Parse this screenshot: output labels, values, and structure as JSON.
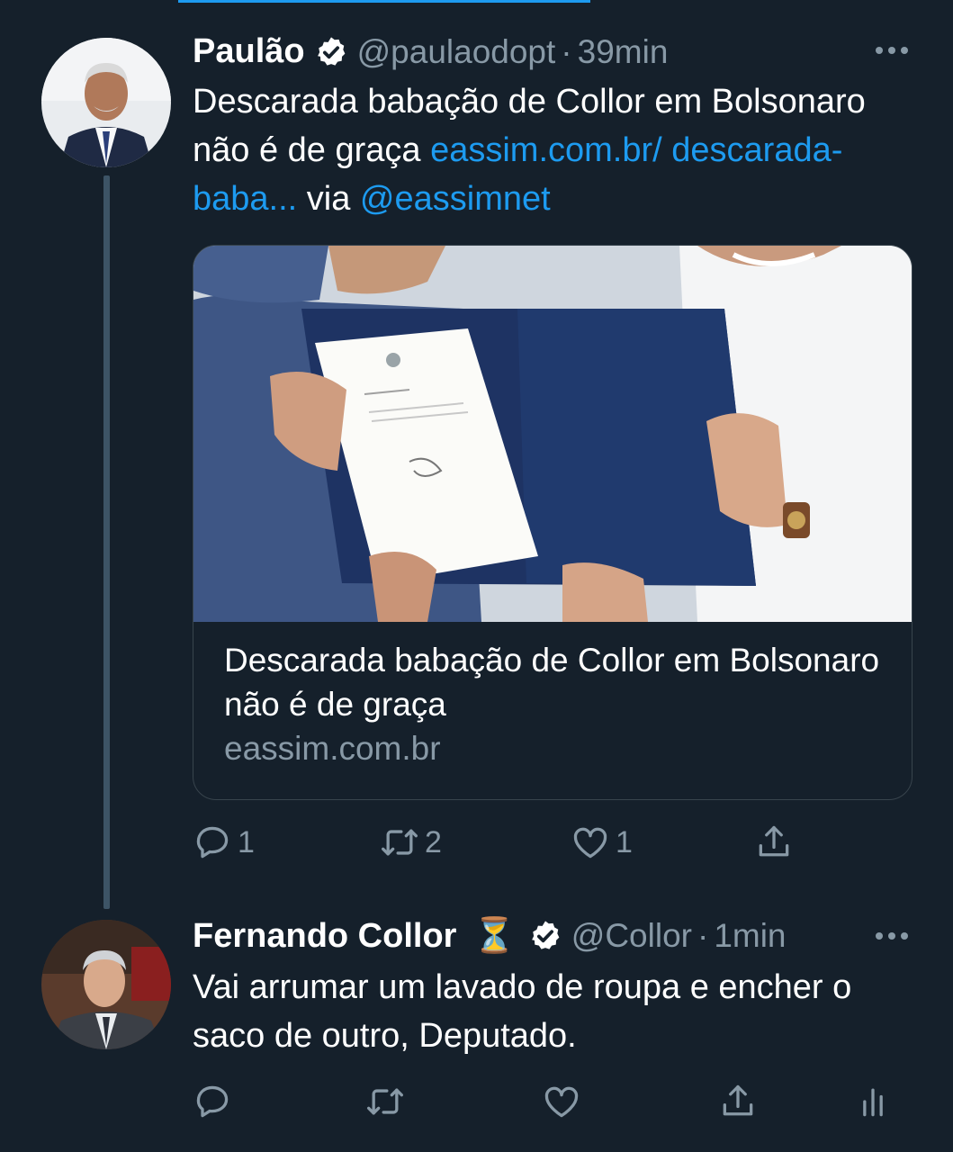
{
  "colors": {
    "background": "#15202b",
    "text_primary": "#ffffff",
    "text_secondary": "#8899a6",
    "link": "#1d9bf0",
    "border": "#38444d"
  },
  "tweets": [
    {
      "author": {
        "name": "Paulão",
        "verified": true,
        "handle": "@paulaodopt",
        "avatar_icon": "avatar-paulao"
      },
      "separator": "·",
      "time": "39min",
      "text": {
        "part1": "Descarada babação de Collor em Bolsonaro não é de graça ",
        "link1": "eassim.com.br/ descarada-baba...",
        "part2": " via ",
        "mention": "@eassimnet"
      },
      "card": {
        "title": "Descarada babação de Collor em Bolsonaro não é de graça",
        "domain": "eassim.com.br"
      },
      "actions": {
        "replies": "1",
        "retweets": "2",
        "likes": "1"
      }
    },
    {
      "author": {
        "name": "Fernando Collor",
        "emoji": "⏳",
        "verified": true,
        "handle": "@Collor",
        "avatar_icon": "avatar-collor"
      },
      "separator": "·",
      "time": "1min",
      "text": "Vai arrumar um lavado de roupa e encher o saco de outro,  Deputado.",
      "actions": {
        "replies": "",
        "retweets": "",
        "likes": ""
      }
    }
  ]
}
